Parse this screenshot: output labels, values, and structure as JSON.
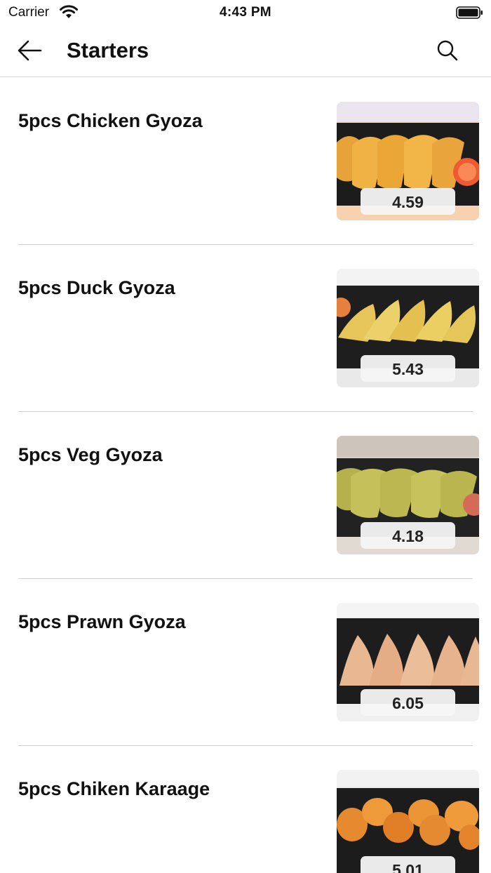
{
  "status_bar": {
    "carrier": "Carrier",
    "time": "4:43 PM"
  },
  "nav": {
    "title": "Starters",
    "back_icon": "arrow-left-icon",
    "search_icon": "search-icon"
  },
  "items": [
    {
      "name": "5pcs Chicken Gyoza",
      "price": "4.59"
    },
    {
      "name": "5pcs Duck Gyoza",
      "price": "5.43"
    },
    {
      "name": "5pcs Veg Gyoza",
      "price": "4.18"
    },
    {
      "name": "5pcs Prawn Gyoza",
      "price": "6.05"
    },
    {
      "name": "5pcs Chiken Karaage",
      "price": "5.01"
    }
  ]
}
